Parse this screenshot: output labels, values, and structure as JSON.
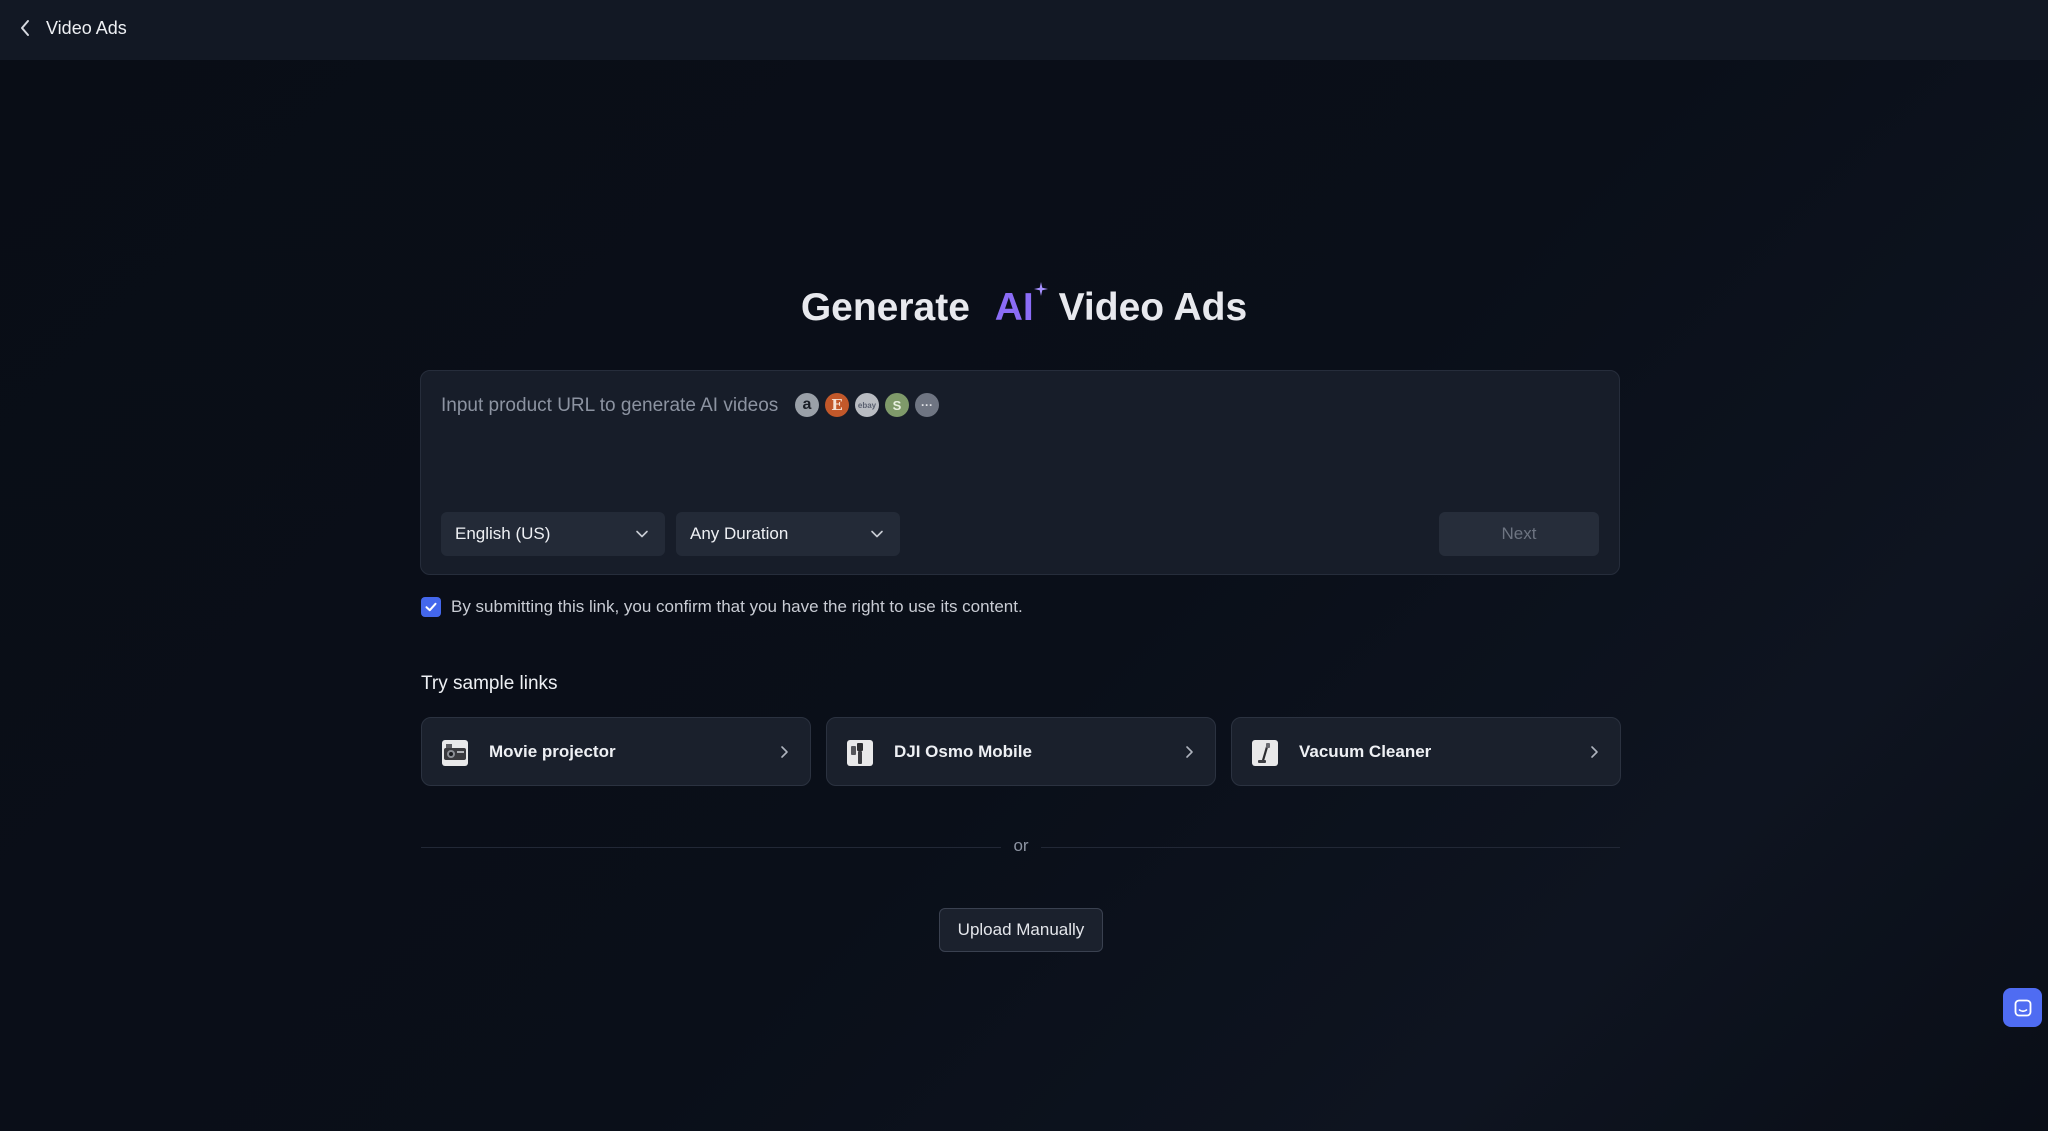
{
  "header": {
    "title": "Video Ads",
    "back_icon": "chevron-left-icon"
  },
  "hero": {
    "prefix": "Generate",
    "highlight": "AI",
    "suffix": "Video Ads",
    "highlight_color": "#8b6cf6"
  },
  "url_input": {
    "placeholder": "Input product URL to generate AI videos",
    "platform_icons": [
      {
        "name": "amazon-icon",
        "glyph": "a"
      },
      {
        "name": "etsy-icon",
        "glyph": "E"
      },
      {
        "name": "ebay-icon",
        "glyph": "ebay"
      },
      {
        "name": "shopify-icon",
        "glyph": "S"
      },
      {
        "name": "more-icon",
        "glyph": "···"
      }
    ]
  },
  "language_select": {
    "value": "English (US)"
  },
  "duration_select": {
    "value": "Any Duration"
  },
  "next_button": {
    "label": "Next"
  },
  "consent": {
    "checked": true,
    "text": "By submitting this link, you confirm that you have the right to use its content."
  },
  "samples": {
    "title": "Try sample links",
    "items": [
      {
        "label": "Movie projector"
      },
      {
        "label": "DJI Osmo Mobile"
      },
      {
        "label": "Vacuum Cleaner"
      }
    ]
  },
  "divider": {
    "text": "or"
  },
  "upload_button": {
    "label": "Upload Manually"
  },
  "colors": {
    "accent": "#4467ec",
    "chat_button": "#4f6cf2",
    "background": "#0a0f19"
  }
}
